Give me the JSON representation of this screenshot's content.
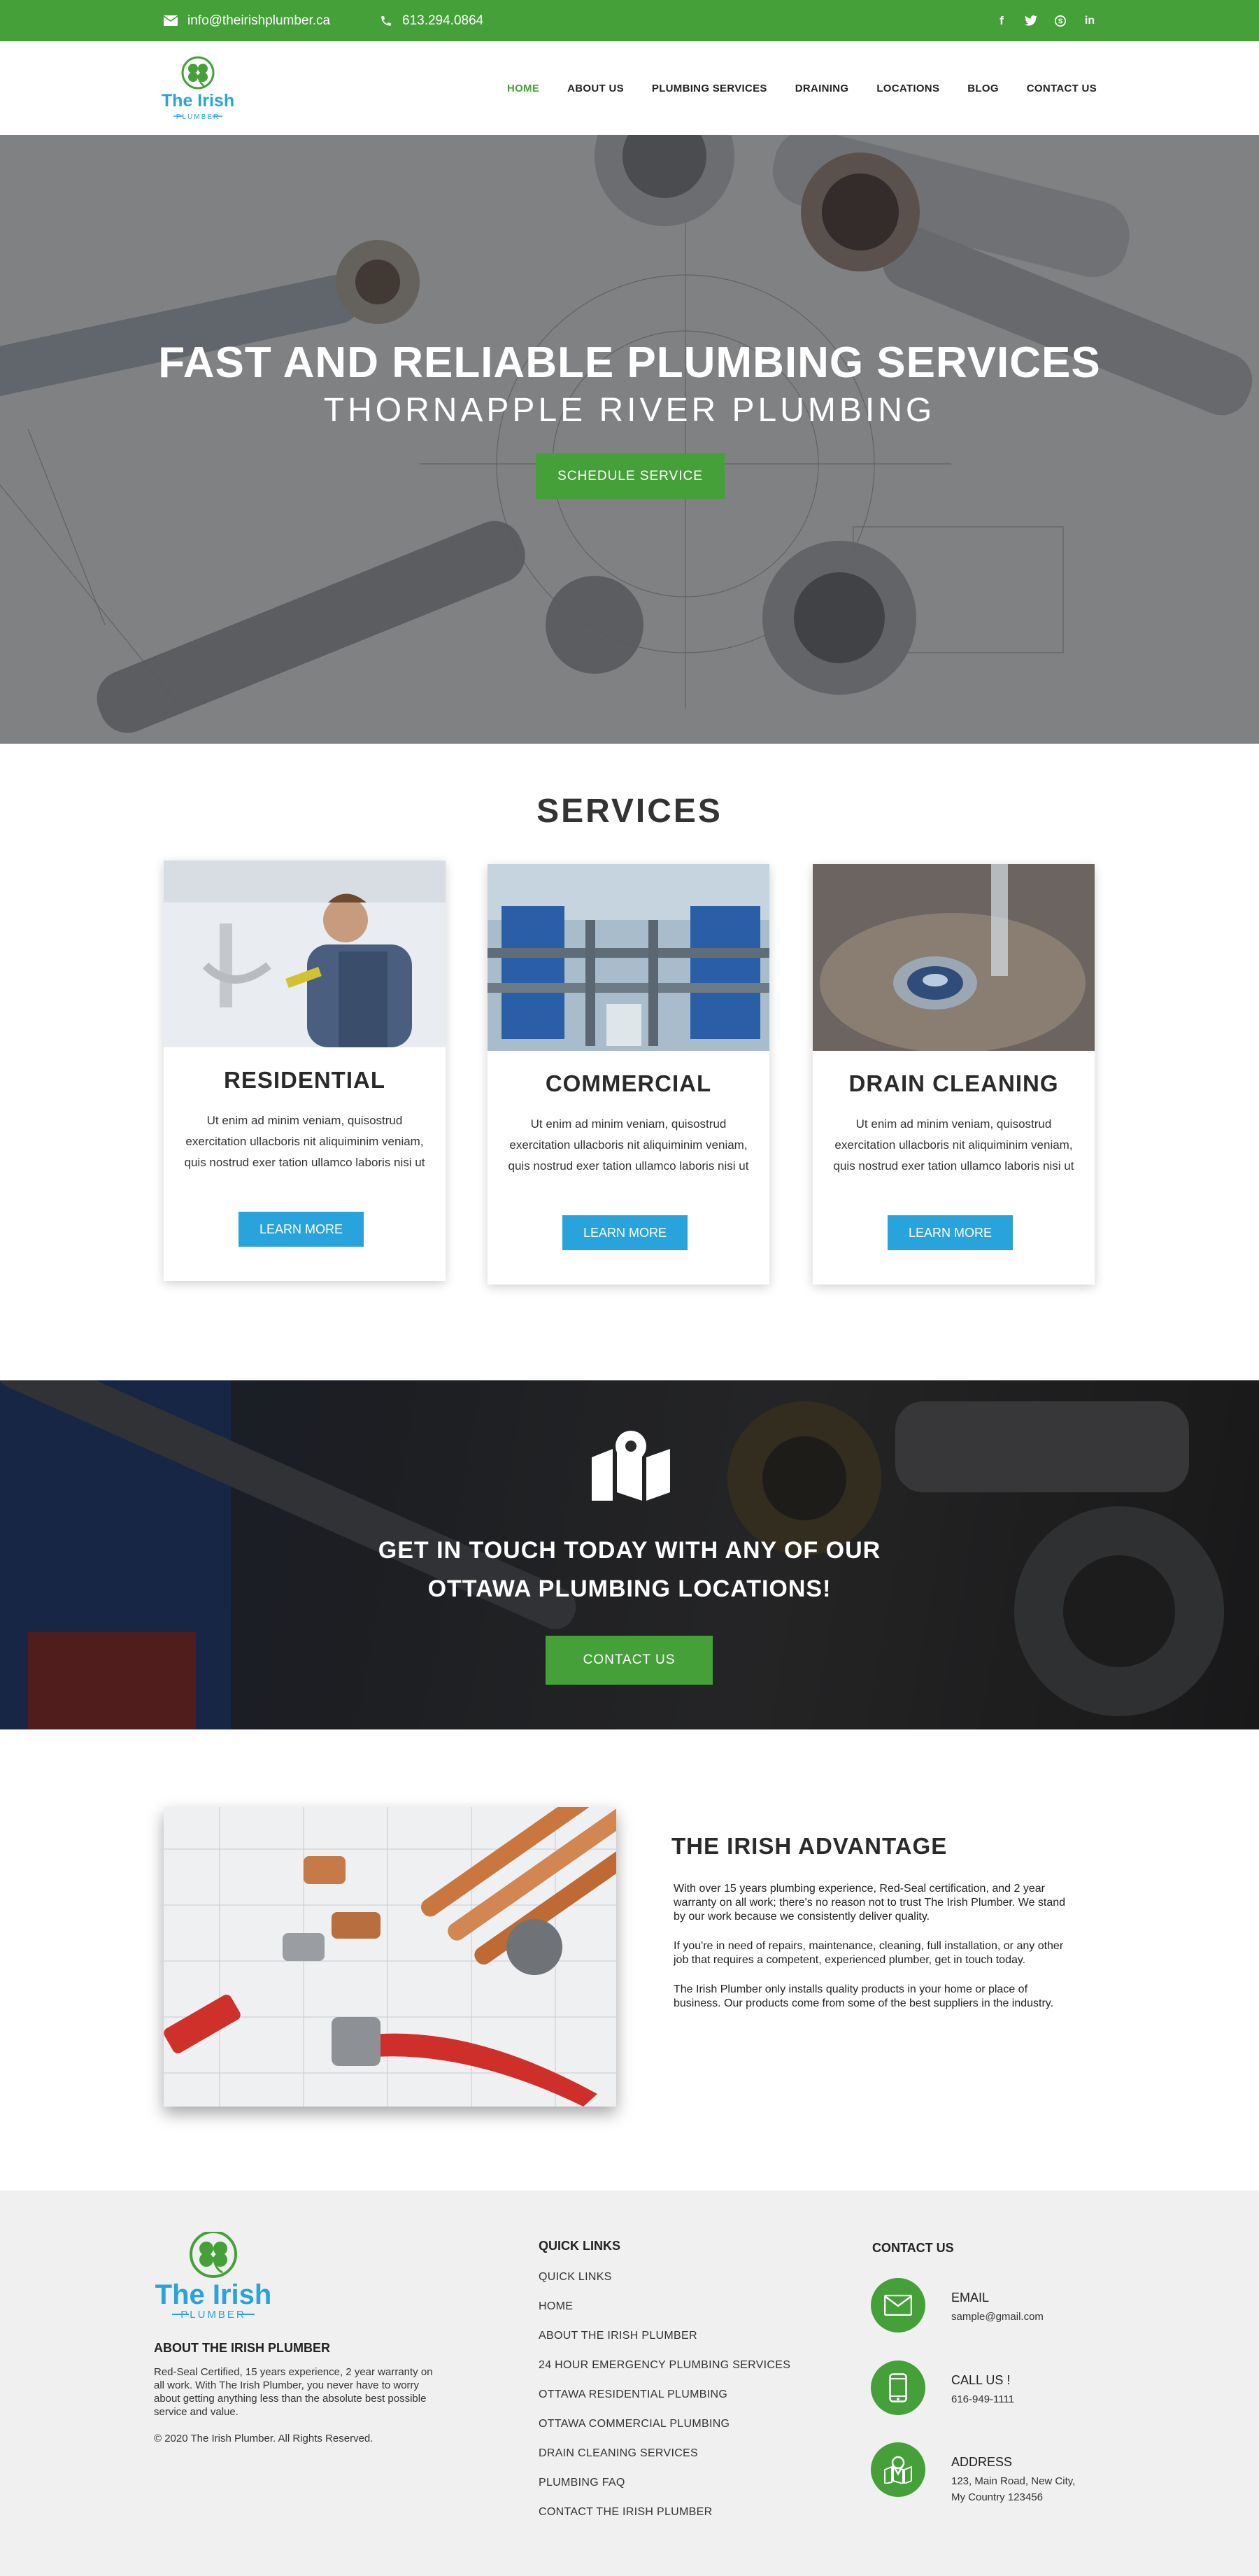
{
  "topbar": {
    "email": "info@theirishplumber.ca",
    "phone": "613.294.0864",
    "social": [
      "facebook-icon",
      "twitter-icon",
      "skype-icon",
      "linkedin-icon"
    ]
  },
  "brand": {
    "name_line1": "The Irish",
    "name_line2": "PLUMBER",
    "green": "#45a03a",
    "blue": "#29a3dc"
  },
  "nav": [
    "HOME",
    "ABOUT US",
    "PLUMBING SERVICES",
    "DRAINING",
    "LOCATIONS",
    "BLOG",
    "CONTACT US"
  ],
  "hero": {
    "title": "FAST AND RELIABLE PLUMBING SERVICES",
    "subtitle": "THORNAPPLE RIVER PLUMBING",
    "button": "SCHEDULE SERVICE"
  },
  "services": {
    "title": "SERVICES",
    "cards": [
      {
        "title": "RESIDENTIAL",
        "text": "Ut enim ad minim veniam, quisostrud exercitation ullacboris nit aliquiminim veniam, quis nostrud exer tation ullamco laboris nisi ut",
        "button": "LEARN MORE"
      },
      {
        "title": "COMMERCIAL",
        "text": "Ut enim ad minim veniam, quisostrud exercitation ullacboris nit aliquiminim veniam, quis nostrud exer tation ullamco laboris nisi ut",
        "button": "LEARN MORE"
      },
      {
        "title": "DRAIN CLEANING",
        "text": "Ut enim ad minim veniam, quisostrud exercitation ullacboris nit aliquiminim veniam, quis nostrud exer tation ullamco laboris nisi ut",
        "button": "LEARN MORE"
      }
    ]
  },
  "locations": {
    "line1": "GET IN TOUCH TODAY WITH ANY OF OUR",
    "line2": "OTTAWA PLUMBING LOCATIONS!",
    "button": "CONTACT US"
  },
  "advantage": {
    "title": "THE IRISH ADVANTAGE",
    "paragraphs": [
      "With over 15 years plumbing experience, Red-Seal certification, and 2 year warranty on all work; there's no reason not to trust The Irish Plumber. We stand by our work because we consistently deliver quality.",
      "If you're in need of repairs, maintenance, cleaning, full installation, or any other job that requires a competent, experienced plumber, get in touch today.",
      "The Irish Plumber only installs quality products in your home or place of business. Our products come from some of the best suppliers in the industry."
    ]
  },
  "footer": {
    "about_title": "ABOUT THE IRISH PLUMBER",
    "about_text": "Red-Seal Certified, 15 years experience, 2 year warranty on all work. With The Irish Plumber, you never have to worry about getting anything less than the absolute best possible service and value.",
    "copyright": "© 2020 The Irish Plumber. All Rights Reserved.",
    "links_title": "QUICK LINKS",
    "links": [
      "QUICK LINKS",
      "HOME",
      "ABOUT THE IRISH PLUMBER",
      "24 HOUR EMERGENCY PLUMBING SERVICES",
      "OTTAWA RESIDENTIAL PLUMBING",
      "OTTAWA COMMERCIAL PLUMBING",
      "DRAIN CLEANING SERVICES",
      "PLUMBING FAQ",
      "CONTACT THE IRISH PLUMBER"
    ],
    "contact_title": "CONTACT US",
    "email_label": "EMAIL",
    "email_value": "sample@gmail.com",
    "call_label": "CALL US !",
    "call_value": "616-949-1111",
    "address_label": "ADDRESS",
    "address_line1": "123, Main Road, New City,",
    "address_line2": "My Country 123456"
  }
}
